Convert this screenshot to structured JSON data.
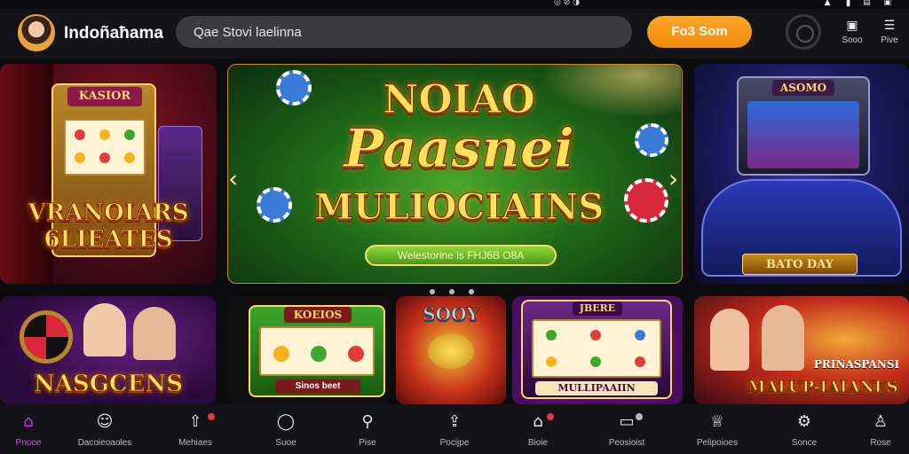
{
  "status": {
    "left_icons": "◎ ⊘ ◑",
    "right_icons": "▲ ▐ ▤ ▣"
  },
  "header": {
    "brand": "Indoñaħama",
    "search_placeholder": "Qae Stovi laelinna",
    "cta": "Fo3 Som",
    "buttons": [
      {
        "label": "Sooo",
        "icon": "chat-icon"
      },
      {
        "label": "Pive",
        "icon": "menu-icon"
      }
    ]
  },
  "hero": {
    "line1": "NOIAO",
    "line2": "Paasnei",
    "line3": "MULIOCIAINS",
    "banner": "Welestorine is FHJ6B O8A",
    "slides": 3
  },
  "left_panel": {
    "sign": "KASIOR",
    "line1": "VRANOIARS",
    "line2": "6LIEATES"
  },
  "right_panel": {
    "sign": "ASOMO",
    "plate": "BATO DAY"
  },
  "bottom_panels": [
    {
      "title": "NASGCENS"
    },
    {
      "sign": "KOEIOS",
      "plate": "Sinos beet"
    },
    {
      "sign": "SOOY"
    },
    {
      "sign": "JBERE",
      "plate": "MULLIPAAIIN"
    },
    {
      "line1": "PRINASPANSI",
      "line2": "MALUP-IAIANES"
    }
  ],
  "nav": [
    {
      "label": "Pnooe",
      "icon": "home-icon",
      "active": true
    },
    {
      "label": "Dacoieoaoles",
      "icon": "face-icon",
      "active": false
    },
    {
      "label": "Mehiaes",
      "icon": "upload-icon",
      "active": false
    },
    {
      "label": "Suoe",
      "icon": "chat-icon",
      "active": false
    },
    {
      "label": "Pise",
      "icon": "search-icon",
      "active": false
    },
    {
      "label": "Pocijpe",
      "icon": "share-icon",
      "active": false
    },
    {
      "label": "Bioie",
      "icon": "tag-icon",
      "active": false
    },
    {
      "label": "Peosioist",
      "icon": "window-icon",
      "active": false
    },
    {
      "label": "Pelipoioes",
      "icon": "hat-icon",
      "active": false
    },
    {
      "label": "Sonce",
      "icon": "settings-icon",
      "active": false
    },
    {
      "label": "Rose",
      "icon": "user-icon",
      "active": false
    }
  ],
  "colors": {
    "accent": "#f5931c",
    "active_nav": "#d94ef0",
    "badge": "#e23b3b"
  }
}
